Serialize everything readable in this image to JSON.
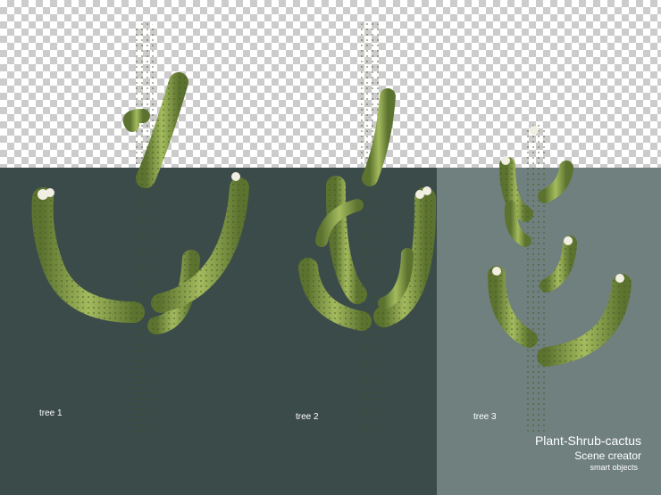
{
  "colors": {
    "dark_panel": "#3b4b4a",
    "light_panel": "#6f807e",
    "cactus_green": "#8aa34a",
    "flower": "#f1eee2"
  },
  "labels": {
    "tree1": "tree 1",
    "tree2": "tree 2",
    "tree3": "tree 3"
  },
  "footer": {
    "title": "Plant-Shrub-cactus",
    "subtitle": "Scene creator",
    "caption": "smart objects"
  }
}
